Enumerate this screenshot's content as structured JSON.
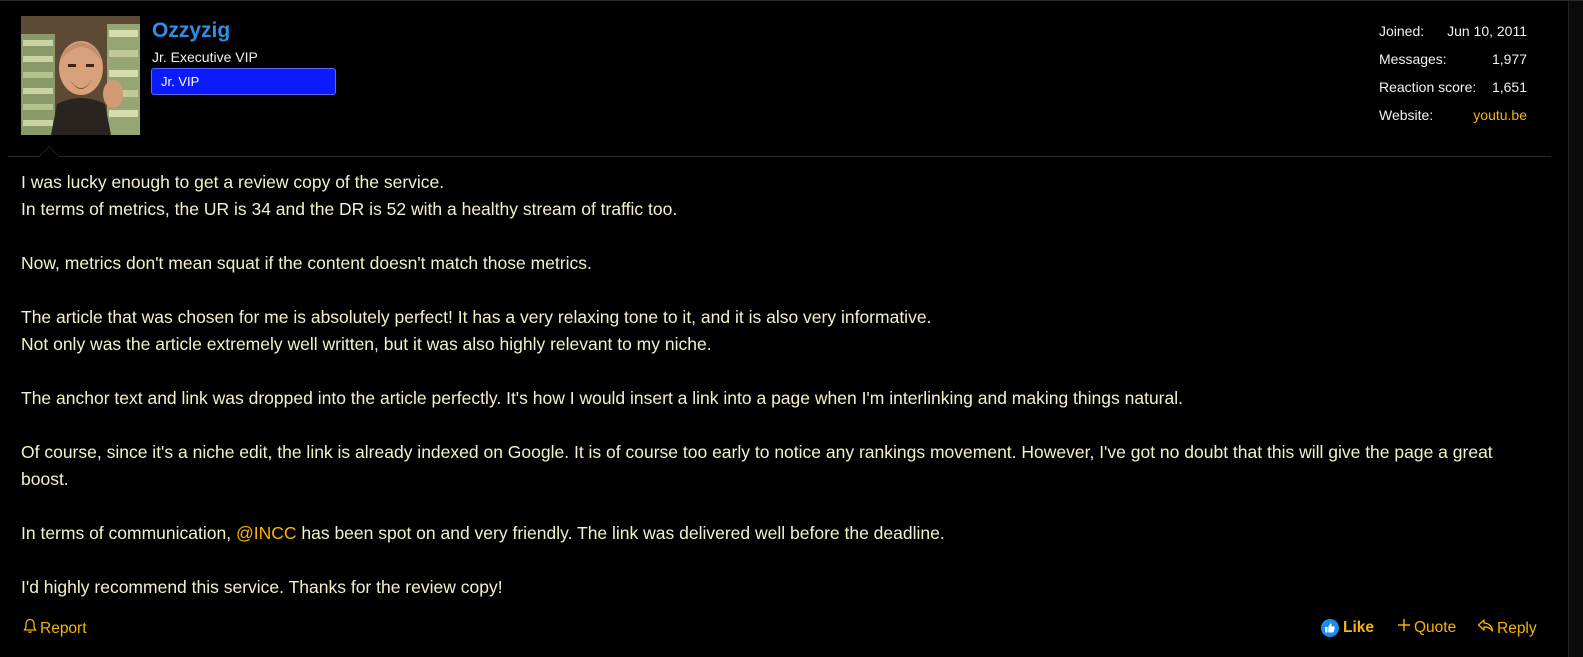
{
  "user": {
    "name": "Ozzyzig",
    "title": "Jr. Executive VIP",
    "banner": "Jr. VIP"
  },
  "stats": [
    {
      "label": "Joined:",
      "value": "Jun 10, 2011",
      "is_link": false
    },
    {
      "label": "Messages:",
      "value": "1,977",
      "is_link": false
    },
    {
      "label": "Reaction score:",
      "value": "1,651",
      "is_link": false
    },
    {
      "label": "Website:",
      "value": "youtu.be",
      "is_link": true
    }
  ],
  "message": {
    "p1_l1": "I was lucky enough to get a review copy of the service.",
    "p1_l2": "In terms of metrics, the UR is 34 and the DR is 52 with a healthy stream of traffic too.",
    "p2": "Now, metrics don't mean squat if the content doesn't match those metrics.",
    "p3_l1": "The article that was chosen for me is absolutely perfect! It has a very relaxing tone to it, and it is also very informative.",
    "p3_l2": "Not only was the article extremely well written, but it was also highly relevant to my niche.",
    "p4": "The anchor text and link was dropped into the article perfectly. It's how I would insert a link into a page when I'm interlinking and making things natural.",
    "p5": "Of course, since it's a niche edit, the link is already indexed on Google. It is of course too early to notice any rankings movement. However, I've got no doubt that this will give the page a great boost.",
    "p6_pre": "In terms of communication, ",
    "p6_mention": "@INCC",
    "p6_post": " has been spot on and very friendly. The link was delivered well before the deadline.",
    "p7": "I'd highly recommend this service. Thanks for the review copy!"
  },
  "actions": {
    "report": "Report",
    "like": "Like",
    "quote": "Quote",
    "reply": "Reply"
  },
  "icons": {
    "report": "bell-icon",
    "like": "thumbs-up-icon",
    "quote": "plus-icon",
    "reply": "reply-arrow-icon"
  },
  "colors": {
    "username": "#2f8fe8",
    "link": "#f7b500",
    "banner": "#0c1aff",
    "body_text": "#f4f1c9",
    "background": "#000000"
  }
}
